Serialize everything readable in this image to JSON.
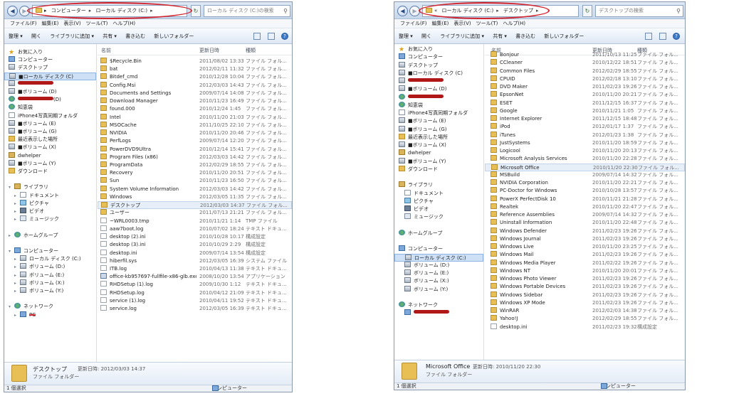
{
  "menu": [
    "ファイル(F)",
    "編集(E)",
    "表示(V)",
    "ツール(T)",
    "ヘルプ(H)"
  ],
  "toolbar": {
    "organize": "整理 ▾",
    "open": "開く",
    "add_library": "ライブラリに追加 ▾",
    "share": "共有 ▾",
    "burn": "書き込む",
    "new_folder": "新しいフォルダー"
  },
  "columns": {
    "name": "名前",
    "date": "更新日時",
    "type": "種類"
  },
  "left": {
    "address": [
      "コンピューター",
      "ローカル ディスク (C:)"
    ],
    "search_placeholder": "ローカル ディスク (C:)の検索",
    "nav": [
      {
        "label": "お気に入り",
        "icon": "star",
        "sel": false
      },
      {
        "label": "コンピューター",
        "icon": "comp",
        "sel": false
      },
      {
        "label": "デスクトップ",
        "icon": "drive",
        "sel": false
      },
      {
        "label": "■ローカル ディスク (C)",
        "icon": "drive",
        "sel": true
      },
      {
        "label": "",
        "icon": "drive",
        "sel": false,
        "redact": true
      },
      {
        "label": "■ボリューム (D)",
        "icon": "drive",
        "sel": false
      },
      {
        "label": "(D)",
        "icon": "globe",
        "sel": false,
        "redact": true
      },
      {
        "label": "知恵袋",
        "icon": "globe",
        "sel": false
      },
      {
        "label": "iPhone4写真同期フォルダ",
        "icon": "doc",
        "sel": false
      },
      {
        "label": "■ボリューム (E)",
        "icon": "drive",
        "sel": false
      },
      {
        "label": "■ボリューム (G)",
        "icon": "drive",
        "sel": false
      },
      {
        "label": "最近表示した場所",
        "icon": "folder",
        "sel": false
      },
      {
        "label": "■ボリューム (X)",
        "icon": "drive",
        "sel": false
      },
      {
        "label": "dwhelper",
        "icon": "lib",
        "sel": false
      },
      {
        "label": "■ボリューム (Y)",
        "icon": "drive",
        "sel": false
      },
      {
        "label": "ダウンロード",
        "icon": "folder",
        "sel": false
      },
      {
        "label": "",
        "icon": "",
        "sel": false,
        "gap": true
      },
      {
        "label": "ライブラリ",
        "icon": "lib",
        "sel": false,
        "arrow": "▾"
      },
      {
        "label": "ドキュメント",
        "icon": "doc",
        "sel": false,
        "arrow": "▸",
        "indent": true
      },
      {
        "label": "ピクチャ",
        "icon": "pic",
        "sel": false,
        "arrow": "▸",
        "indent": true
      },
      {
        "label": "ビデオ",
        "icon": "vid",
        "sel": false,
        "arrow": "▸",
        "indent": true
      },
      {
        "label": "ミュージック",
        "icon": "mus",
        "sel": false,
        "arrow": "▸",
        "indent": true
      },
      {
        "label": "",
        "icon": "",
        "sel": false,
        "gap": true
      },
      {
        "label": "ホームグループ",
        "icon": "globe",
        "sel": false,
        "arrow": "▸"
      },
      {
        "label": "",
        "icon": "",
        "sel": false,
        "gap": true
      },
      {
        "label": "コンピューター",
        "icon": "comp",
        "sel": false,
        "arrow": "▾"
      },
      {
        "label": "ローカル ディスク (C:)",
        "icon": "drive",
        "sel": false,
        "arrow": "▸",
        "indent": true
      },
      {
        "label": "ボリューム (D:)",
        "icon": "drive",
        "sel": false,
        "arrow": "▸",
        "indent": true
      },
      {
        "label": "ボリューム (E:)",
        "icon": "drive",
        "sel": false,
        "arrow": "▸",
        "indent": true
      },
      {
        "label": "ボリューム (X:)",
        "icon": "drive",
        "sel": false,
        "arrow": "▸",
        "indent": true
      },
      {
        "label": "ボリューム (Y:)",
        "icon": "drive",
        "sel": false,
        "arrow": "▸",
        "indent": true
      },
      {
        "label": "",
        "icon": "",
        "sel": false,
        "gap": true
      },
      {
        "label": "ネットワーク",
        "icon": "globe",
        "sel": false,
        "arrow": "▾"
      },
      {
        "label": "PC",
        "icon": "comp",
        "sel": false,
        "arrow": "▸",
        "indent": true,
        "redline": true
      }
    ],
    "files": [
      {
        "name": "$Recycle.Bin",
        "date": "2011/08/02 13:33",
        "type": "ファイル フォル...",
        "icon": "folder"
      },
      {
        "name": "bat",
        "date": "2012/02/11 11:32",
        "type": "ファイル フォル...",
        "icon": "folder"
      },
      {
        "name": "Bitdef_cmd",
        "date": "2010/12/28 10:04",
        "type": "ファイル フォル...",
        "icon": "folder"
      },
      {
        "name": "Config.Msi",
        "date": "2012/03/03 14:43",
        "type": "ファイル フォル...",
        "icon": "folder"
      },
      {
        "name": "Documents and Settings",
        "date": "2009/07/14 14:08",
        "type": "ファイル フォル...",
        "icon": "folder"
      },
      {
        "name": "Download Manager",
        "date": "2010/11/23 16:49",
        "type": "ファイル フォル...",
        "icon": "folder"
      },
      {
        "name": "found.000",
        "date": "2010/12/24 1:45",
        "type": "ファイル フォル...",
        "icon": "folder"
      },
      {
        "name": "Intel",
        "date": "2010/11/20 21:03",
        "type": "ファイル フォル...",
        "icon": "folder"
      },
      {
        "name": "MSOCache",
        "date": "2011/10/25 22:10",
        "type": "ファイル フォル...",
        "icon": "folder"
      },
      {
        "name": "NVIDIA",
        "date": "2010/11/20 20:46",
        "type": "ファイル フォル...",
        "icon": "folder"
      },
      {
        "name": "PerfLogs",
        "date": "2009/07/14 12:20",
        "type": "ファイル フォル...",
        "icon": "folder"
      },
      {
        "name": "PowerDVD9Ultra",
        "date": "2010/12/14 15:41",
        "type": "ファイル フォル...",
        "icon": "folder"
      },
      {
        "name": "Program Files (x86)",
        "date": "2012/03/03 14:42",
        "type": "ファイル フォル...",
        "icon": "folder"
      },
      {
        "name": "ProgramData",
        "date": "2012/02/29 18:55",
        "type": "ファイル フォル...",
        "icon": "folder"
      },
      {
        "name": "Recovery",
        "date": "2010/11/20 20:51",
        "type": "ファイル フォル...",
        "icon": "folder"
      },
      {
        "name": "Sun",
        "date": "2010/11/23 16:50",
        "type": "ファイル フォル...",
        "icon": "folder"
      },
      {
        "name": "System Volume Information",
        "date": "2012/03/03 14:42",
        "type": "ファイル フォル...",
        "icon": "folder"
      },
      {
        "name": "Windows",
        "date": "2012/03/05 11:35",
        "type": "ファイル フォル...",
        "icon": "folder"
      },
      {
        "name": "デスクトップ",
        "date": "2012/03/03 14:37",
        "type": "ファイル フォル...",
        "icon": "folder",
        "sel": true
      },
      {
        "name": "ユーザー",
        "date": "2011/07/13 21:21",
        "type": "ファイル フォル...",
        "icon": "folder"
      },
      {
        "name": "~WRL0003.tmp",
        "date": "2010/11/21 1:14",
        "type": "TMP ファイル",
        "icon": "file"
      },
      {
        "name": "aaw7boot.log",
        "date": "2010/07/02 18:24",
        "type": "テキスト ドキュ...",
        "icon": "file"
      },
      {
        "name": "desktop (2).ini",
        "date": "2010/10/28 10:17",
        "type": "構成設定",
        "icon": "file"
      },
      {
        "name": "desktop (3).ini",
        "date": "2010/10/29 2:29",
        "type": "構成設定",
        "icon": "file"
      },
      {
        "name": "desktop.ini",
        "date": "2009/07/14 13:54",
        "type": "構成設定",
        "icon": "file"
      },
      {
        "name": "hiberfil.sys",
        "date": "2012/03/05 16:39",
        "type": "システム ファイル",
        "icon": "file"
      },
      {
        "name": "ITB.log",
        "date": "2010/04/13 11:38",
        "type": "テキスト ドキュ...",
        "icon": "file"
      },
      {
        "name": "office-kb957697-fullfile-x86-glb.exe",
        "date": "2008/10/20 13:54",
        "type": "アプリケーション",
        "icon": "exe"
      },
      {
        "name": "RHDSetup (1).log",
        "date": "2009/10/30 1:12",
        "type": "テキスト ドキュ...",
        "icon": "file"
      },
      {
        "name": "RHDSetup.log",
        "date": "2010/04/12 21:09",
        "type": "テキスト ドキュ...",
        "icon": "file"
      },
      {
        "name": "service (1).log",
        "date": "2010/04/11 19:52",
        "type": "テキスト ドキュ...",
        "icon": "file"
      },
      {
        "name": "service.log",
        "date": "2012/03/05 16:39",
        "type": "テキスト ドキュ...",
        "icon": "file"
      }
    ],
    "detail": {
      "name": "デスクトップ",
      "meta": "更新日時: 2012/03/03 14:37",
      "type": "ファイル フォルダー"
    },
    "status": "1 個選択",
    "status_loc": "コンピューター"
  },
  "right": {
    "address": [
      "ローカル ディスク (C:)",
      "デスクトップ"
    ],
    "search_placeholder": "デスクトップの検索",
    "nav": [
      {
        "label": "お気に入り",
        "icon": "star",
        "sel": false
      },
      {
        "label": "コンピューター",
        "icon": "comp",
        "sel": false
      },
      {
        "label": "デスクトップ",
        "icon": "drive",
        "sel": false
      },
      {
        "label": "■ローカル ディスク (C)",
        "icon": "drive",
        "sel": false
      },
      {
        "label": "",
        "icon": "drive",
        "sel": false,
        "redact": true
      },
      {
        "label": "■ボリューム (D)",
        "icon": "drive",
        "sel": false
      },
      {
        "label": "",
        "icon": "globe",
        "sel": false,
        "redact": true
      },
      {
        "label": "知恵袋",
        "icon": "globe",
        "sel": false
      },
      {
        "label": "iPhone4写真同期フォルダ",
        "icon": "doc",
        "sel": false
      },
      {
        "label": "■ボリューム (E)",
        "icon": "drive",
        "sel": false
      },
      {
        "label": "■ボリューム (G)",
        "icon": "drive",
        "sel": false
      },
      {
        "label": "最近表示した場所",
        "icon": "folder",
        "sel": false
      },
      {
        "label": "■ボリューム (X)",
        "icon": "drive",
        "sel": false
      },
      {
        "label": "dwhelper",
        "icon": "lib",
        "sel": false
      },
      {
        "label": "■ボリューム (Y)",
        "icon": "drive",
        "sel": false
      },
      {
        "label": "ダウンロード",
        "icon": "folder",
        "sel": false
      },
      {
        "label": "",
        "icon": "",
        "sel": false,
        "gap": true
      },
      {
        "label": "ライブラリ",
        "icon": "lib",
        "sel": false
      },
      {
        "label": "ドキュメント",
        "icon": "doc",
        "sel": false,
        "indent": true
      },
      {
        "label": "ピクチャ",
        "icon": "pic",
        "sel": false,
        "indent": true
      },
      {
        "label": "ビデオ",
        "icon": "vid",
        "sel": false,
        "indent": true
      },
      {
        "label": "ミュージック",
        "icon": "mus",
        "sel": false,
        "indent": true
      },
      {
        "label": "",
        "icon": "",
        "sel": false,
        "gap": true
      },
      {
        "label": "ホームグループ",
        "icon": "globe",
        "sel": false
      },
      {
        "label": "",
        "icon": "",
        "sel": false,
        "gap": true
      },
      {
        "label": "コンピューター",
        "icon": "comp",
        "sel": false
      },
      {
        "label": "ローカル ディスク (C:)",
        "icon": "drive",
        "sel": true,
        "indent": true
      },
      {
        "label": "ボリューム (D:)",
        "icon": "drive",
        "sel": false,
        "indent": true
      },
      {
        "label": "ボリューム (E:)",
        "icon": "drive",
        "sel": false,
        "indent": true
      },
      {
        "label": "ボリューム (X:)",
        "icon": "drive",
        "sel": false,
        "indent": true
      },
      {
        "label": "ボリューム (Y:)",
        "icon": "drive",
        "sel": false,
        "indent": true
      },
      {
        "label": "",
        "icon": "",
        "sel": false,
        "gap": true
      },
      {
        "label": "ネットワーク",
        "icon": "globe",
        "sel": false
      },
      {
        "label": "",
        "icon": "comp",
        "sel": false,
        "indent": true,
        "redact": true
      }
    ],
    "files": [
      {
        "name": "Bonjour",
        "date": "2011/10/13 11:25",
        "type": "ファイル フォル...",
        "icon": "folder"
      },
      {
        "name": "CCleaner",
        "date": "2010/12/22 18:51",
        "type": "ファイル フォル...",
        "icon": "folder"
      },
      {
        "name": "Common Files",
        "date": "2012/02/29 18:55",
        "type": "ファイル フォル...",
        "icon": "folder"
      },
      {
        "name": "CPUID",
        "date": "2012/02/18 13:10",
        "type": "ファイル フォル...",
        "icon": "folder"
      },
      {
        "name": "DVD Maker",
        "date": "2011/02/23 19:26",
        "type": "ファイル フォル...",
        "icon": "folder"
      },
      {
        "name": "EpsonNet",
        "date": "2010/11/20 20:21",
        "type": "ファイル フォル...",
        "icon": "folder"
      },
      {
        "name": "ESET",
        "date": "2011/12/15 16:37",
        "type": "ファイル フォル...",
        "icon": "folder"
      },
      {
        "name": "Google",
        "date": "2010/11/21 1:05",
        "type": "ファイル フォル...",
        "icon": "folder"
      },
      {
        "name": "Internet Explorer",
        "date": "2011/12/15 18:48",
        "type": "ファイル フォル...",
        "icon": "folder"
      },
      {
        "name": "iPod",
        "date": "2012/01/17 1:37",
        "type": "ファイル フォル...",
        "icon": "folder"
      },
      {
        "name": "iTunes",
        "date": "2012/01/23 1:38",
        "type": "ファイル フォル...",
        "icon": "folder"
      },
      {
        "name": "JustSystems",
        "date": "2010/11/20 18:59",
        "type": "ファイル フォル...",
        "icon": "folder"
      },
      {
        "name": "Logicool",
        "date": "2010/11/20 20:13",
        "type": "ファイル フォル...",
        "icon": "folder"
      },
      {
        "name": "Microsoft Analysis Services",
        "date": "2010/11/20 22:28",
        "type": "ファイル フォル...",
        "icon": "folder"
      },
      {
        "name": "Microsoft Office",
        "date": "2010/11/20 22:30",
        "type": "ファイル フォル...",
        "icon": "folder",
        "sel": true
      },
      {
        "name": "MSBuild",
        "date": "2009/07/14 14:32",
        "type": "ファイル フォル...",
        "icon": "folder"
      },
      {
        "name": "NVIDIA Corporation",
        "date": "2010/11/20 22:21",
        "type": "ファイル フォル...",
        "icon": "folder"
      },
      {
        "name": "PC-Doctor for Windows",
        "date": "2010/10/28 13:57",
        "type": "ファイル フォル...",
        "icon": "folder"
      },
      {
        "name": "PowerX PerfectDisk 10",
        "date": "2010/11/21 21:28",
        "type": "ファイル フォル...",
        "icon": "folder"
      },
      {
        "name": "Realtek",
        "date": "2010/11/20 22:47",
        "type": "ファイル フォル...",
        "icon": "folder"
      },
      {
        "name": "Reference Assemblies",
        "date": "2009/07/14 14:32",
        "type": "ファイル フォル...",
        "icon": "folder"
      },
      {
        "name": "Uninstall Information",
        "date": "2010/11/20 22:48",
        "type": "ファイル フォル...",
        "icon": "folder"
      },
      {
        "name": "Windows Defender",
        "date": "2011/02/23 19:26",
        "type": "ファイル フォル...",
        "icon": "folder"
      },
      {
        "name": "Windows Journal",
        "date": "2011/02/23 19:26",
        "type": "ファイル フォル...",
        "icon": "folder"
      },
      {
        "name": "Windows Live",
        "date": "2010/11/20 23:25",
        "type": "ファイル フォル...",
        "icon": "folder"
      },
      {
        "name": "Windows Mail",
        "date": "2011/02/23 19:26",
        "type": "ファイル フォル...",
        "icon": "folder"
      },
      {
        "name": "Windows Media Player",
        "date": "2011/02/22 19:26",
        "type": "ファイル フォル...",
        "icon": "folder"
      },
      {
        "name": "Windows NT",
        "date": "2010/11/20 20:01",
        "type": "ファイル フォル...",
        "icon": "folder"
      },
      {
        "name": "Windows Photo Viewer",
        "date": "2011/02/23 19:26",
        "type": "ファイル フォル...",
        "icon": "folder"
      },
      {
        "name": "Windows Portable Devices",
        "date": "2011/02/23 19:26",
        "type": "ファイル フォル...",
        "icon": "folder"
      },
      {
        "name": "Windows Sidebar",
        "date": "2011/02/23 19:26",
        "type": "ファイル フォル...",
        "icon": "folder"
      },
      {
        "name": "Windows XP Mode",
        "date": "2011/02/23 19:26",
        "type": "ファイル フォル...",
        "icon": "folder"
      },
      {
        "name": "WinRAR",
        "date": "2012/02/03 14:38",
        "type": "ファイル フォル...",
        "icon": "folder"
      },
      {
        "name": "Yahoo!J",
        "date": "2012/02/29 18:55",
        "type": "ファイル フォル...",
        "icon": "folder"
      },
      {
        "name": "desktop.ini",
        "date": "2011/02/23 19:32",
        "type": "構成設定",
        "icon": "file"
      }
    ],
    "detail": {
      "name": "Microsoft Office",
      "meta": "更新日時: 2010/11/20 22:30",
      "type": "ファイル フォルダー"
    },
    "status": "1 個選択",
    "status_loc": "コンピューター"
  }
}
